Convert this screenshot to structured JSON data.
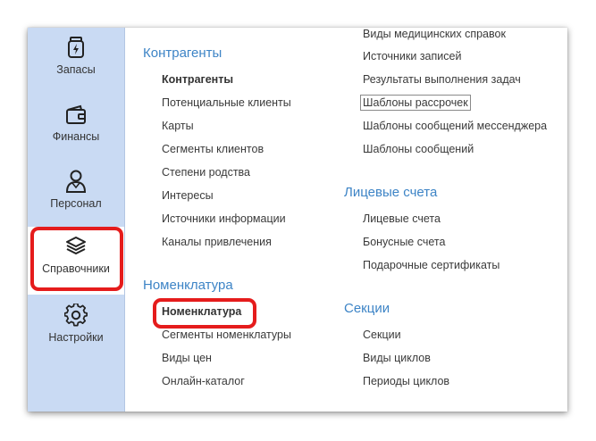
{
  "sidebar": {
    "items": [
      {
        "label": "Запасы",
        "icon": "inventory-jar-icon"
      },
      {
        "label": "Финансы",
        "icon": "wallet-icon"
      },
      {
        "label": "Персонал",
        "icon": "person-icon"
      },
      {
        "label": "Справочники",
        "icon": "layers-stack-icon",
        "active": true
      },
      {
        "label": "Настройки",
        "icon": "gear-icon"
      }
    ]
  },
  "colors": {
    "sidebar_bg": "#c9daf3",
    "section_title": "#3d84c6",
    "highlight": "#e51c1c"
  },
  "sections": {
    "counterparties": {
      "title": "Контрагенты",
      "items": [
        "Контрагенты",
        "Потенциальные клиенты",
        "Карты",
        "Сегменты клиентов",
        "Степени родства",
        "Интересы",
        "Источники информации",
        "Каналы привлечения"
      ]
    },
    "nomenclature": {
      "title": "Номенклатура",
      "items": [
        "Номенклатура",
        "Сегменты номенклатуры",
        "Виды цен",
        "Онлайн-каталог"
      ]
    },
    "misc": {
      "items": [
        "Виды медицинских справок",
        "Источники записей",
        "Результаты выполнения задач",
        "Шаблоны рассрочек",
        "Шаблоны сообщений мессенджера",
        "Шаблоны сообщений"
      ]
    },
    "accounts": {
      "title": "Лицевые счета",
      "items": [
        "Лицевые счета",
        "Бонусные счета",
        "Подарочные сертификаты"
      ]
    },
    "sections_group": {
      "title": "Секции",
      "items": [
        "Секции",
        "Виды циклов",
        "Периоды циклов"
      ]
    }
  }
}
